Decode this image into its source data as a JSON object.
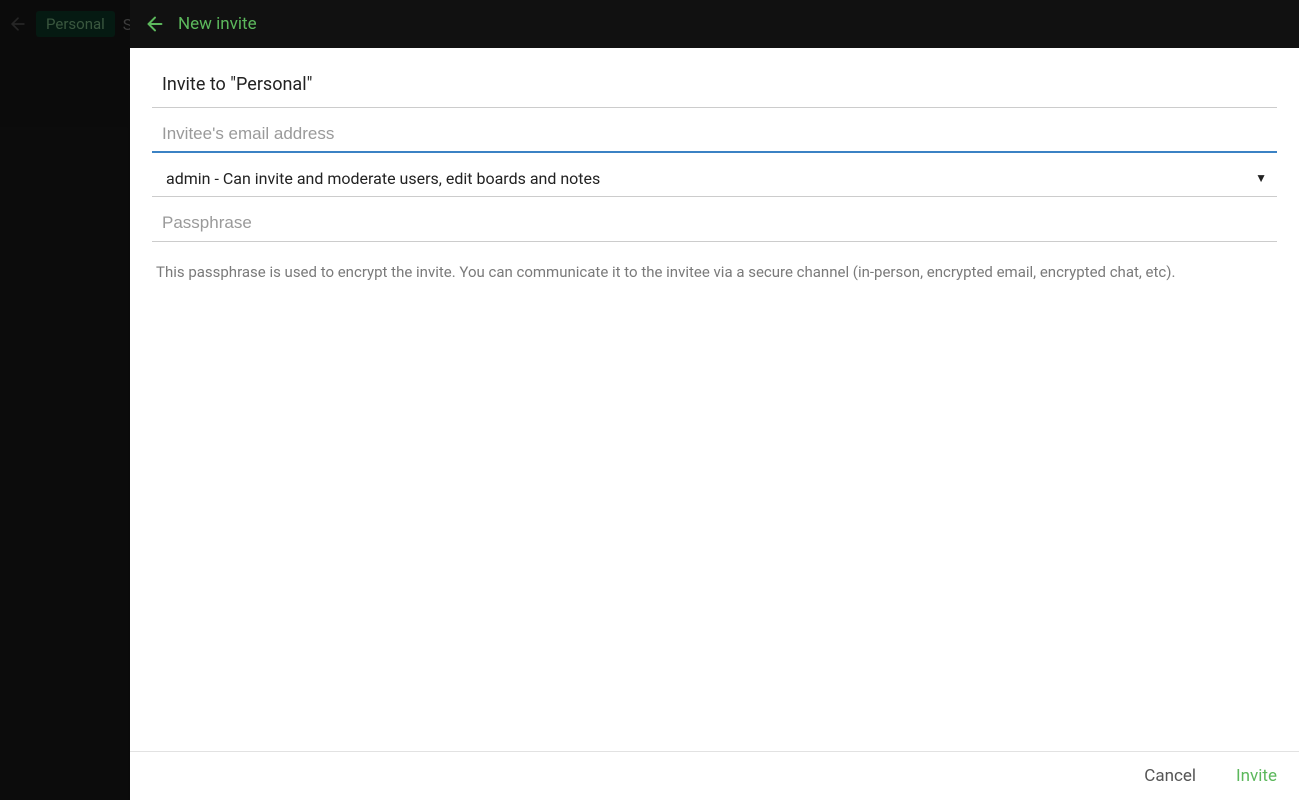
{
  "backdrop": {
    "chip_label": "Personal",
    "trailing_letter": "S"
  },
  "header": {
    "title": "New invite"
  },
  "form": {
    "heading": "Invite to \"Personal\"",
    "email": {
      "value": "",
      "placeholder": "Invitee's email address"
    },
    "role_select": {
      "selected": "admin - Can invite and moderate users, edit boards and notes"
    },
    "passphrase": {
      "value": "",
      "placeholder": "Passphrase"
    },
    "passphrase_help": "This passphrase is used to encrypt the invite. You can communicate it to the invitee via a secure channel (in-person, encrypted email, encrypted chat, etc)."
  },
  "footer": {
    "cancel_label": "Cancel",
    "invite_label": "Invite"
  },
  "colors": {
    "accent_green": "#5cb85c",
    "focus_blue": "#3b82c4"
  }
}
